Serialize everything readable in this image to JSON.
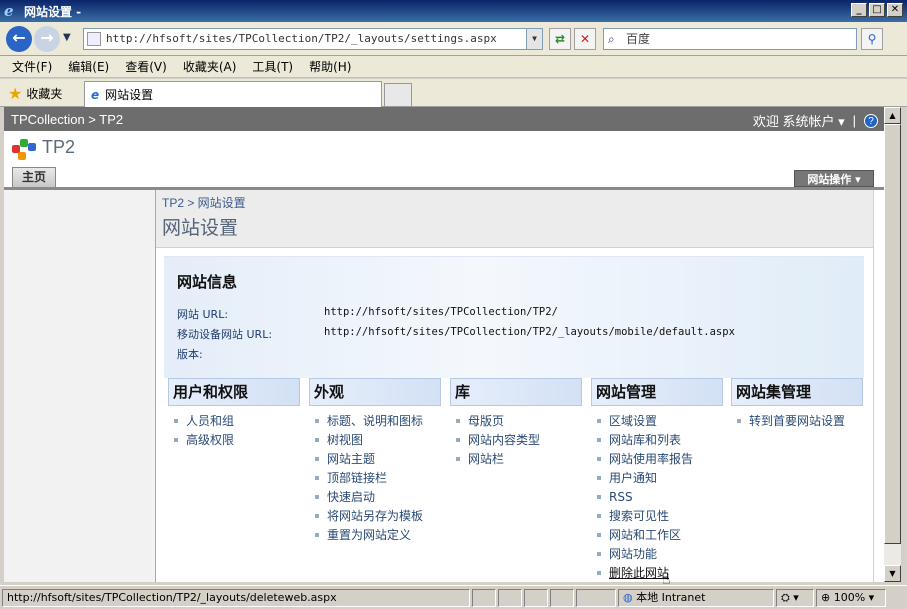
{
  "window": {
    "title": "网站设置 -"
  },
  "address": {
    "url": "http://hfsoft/sites/TPCollection/TP2/_layouts/settings.aspx",
    "search_placeholder": "百度"
  },
  "menu": [
    "文件(F)",
    "编辑(E)",
    "查看(V)",
    "收藏夹(A)",
    "工具(T)",
    "帮助(H)"
  ],
  "favorites": {
    "label": "收藏夹",
    "tab_title": "网站设置"
  },
  "sp": {
    "topnav": "TPCollection > TP2",
    "welcome": "欢迎 系统帐户 ▾",
    "separator": "|",
    "site_title": "TP2",
    "home_tab": "主页",
    "site_actions": "网站操作 ▾",
    "breadcrumb": "TP2 > 网站设置",
    "page_title": "网站设置"
  },
  "site_info": {
    "heading": "网站信息",
    "rows": [
      {
        "label": "网站 URL:",
        "value": "http://hfsoft/sites/TPCollection/TP2/"
      },
      {
        "label": "移动设备网站 URL:",
        "value": "http://hfsoft/sites/TPCollection/TP2/_layouts/mobile/default.aspx"
      },
      {
        "label": "版本:",
        "value": ""
      }
    ]
  },
  "columns": [
    {
      "title": "用户和权限",
      "items": [
        "人员和组",
        "高级权限"
      ]
    },
    {
      "title": "外观",
      "items": [
        "标题、说明和图标",
        "树视图",
        "网站主题",
        "顶部链接栏",
        "快速启动",
        "将网站另存为模板",
        "重置为网站定义"
      ]
    },
    {
      "title": "库",
      "items": [
        "母版页",
        "网站内容类型",
        "网站栏"
      ]
    },
    {
      "title": "网站管理",
      "items": [
        "区域设置",
        "网站库和列表",
        "网站使用率报告",
        "用户通知",
        "RSS",
        "搜索可见性",
        "网站和工作区",
        "网站功能",
        "删除此网站"
      ]
    },
    {
      "title": "网站集管理",
      "items": [
        "转到首要网站设置"
      ]
    }
  ],
  "status": {
    "url": "http://hfsoft/sites/TPCollection/TP2/_layouts/deleteweb.aspx",
    "zone": "本地 Intranet",
    "zoom": "100%"
  }
}
